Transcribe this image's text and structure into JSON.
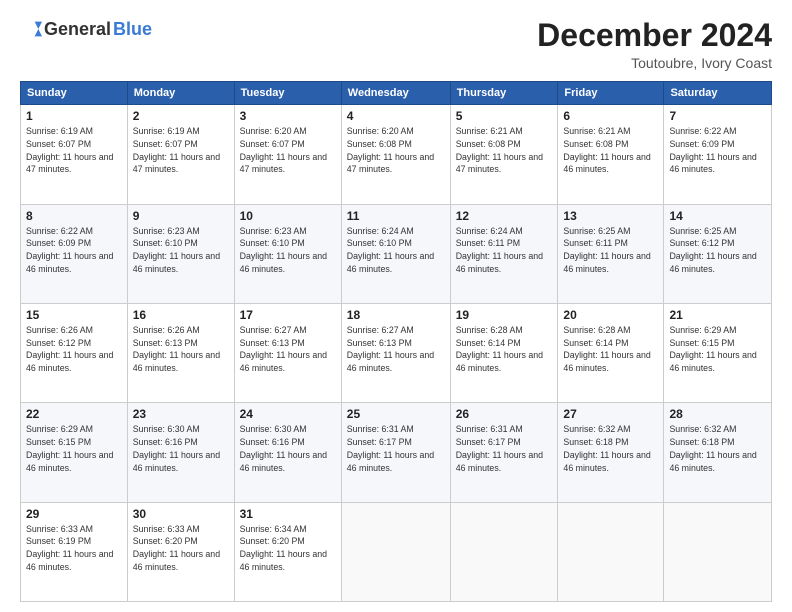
{
  "logo": {
    "general": "General",
    "blue": "Blue"
  },
  "header": {
    "month": "December 2024",
    "location": "Toutoubre, Ivory Coast"
  },
  "weekdays": [
    "Sunday",
    "Monday",
    "Tuesday",
    "Wednesday",
    "Thursday",
    "Friday",
    "Saturday"
  ],
  "weeks": [
    [
      {
        "day": "1",
        "sunrise": "6:19 AM",
        "sunset": "6:07 PM",
        "daylight": "11 hours and 47 minutes."
      },
      {
        "day": "2",
        "sunrise": "6:19 AM",
        "sunset": "6:07 PM",
        "daylight": "11 hours and 47 minutes."
      },
      {
        "day": "3",
        "sunrise": "6:20 AM",
        "sunset": "6:07 PM",
        "daylight": "11 hours and 47 minutes."
      },
      {
        "day": "4",
        "sunrise": "6:20 AM",
        "sunset": "6:08 PM",
        "daylight": "11 hours and 47 minutes."
      },
      {
        "day": "5",
        "sunrise": "6:21 AM",
        "sunset": "6:08 PM",
        "daylight": "11 hours and 47 minutes."
      },
      {
        "day": "6",
        "sunrise": "6:21 AM",
        "sunset": "6:08 PM",
        "daylight": "11 hours and 46 minutes."
      },
      {
        "day": "7",
        "sunrise": "6:22 AM",
        "sunset": "6:09 PM",
        "daylight": "11 hours and 46 minutes."
      }
    ],
    [
      {
        "day": "8",
        "sunrise": "6:22 AM",
        "sunset": "6:09 PM",
        "daylight": "11 hours and 46 minutes."
      },
      {
        "day": "9",
        "sunrise": "6:23 AM",
        "sunset": "6:10 PM",
        "daylight": "11 hours and 46 minutes."
      },
      {
        "day": "10",
        "sunrise": "6:23 AM",
        "sunset": "6:10 PM",
        "daylight": "11 hours and 46 minutes."
      },
      {
        "day": "11",
        "sunrise": "6:24 AM",
        "sunset": "6:10 PM",
        "daylight": "11 hours and 46 minutes."
      },
      {
        "day": "12",
        "sunrise": "6:24 AM",
        "sunset": "6:11 PM",
        "daylight": "11 hours and 46 minutes."
      },
      {
        "day": "13",
        "sunrise": "6:25 AM",
        "sunset": "6:11 PM",
        "daylight": "11 hours and 46 minutes."
      },
      {
        "day": "14",
        "sunrise": "6:25 AM",
        "sunset": "6:12 PM",
        "daylight": "11 hours and 46 minutes."
      }
    ],
    [
      {
        "day": "15",
        "sunrise": "6:26 AM",
        "sunset": "6:12 PM",
        "daylight": "11 hours and 46 minutes."
      },
      {
        "day": "16",
        "sunrise": "6:26 AM",
        "sunset": "6:13 PM",
        "daylight": "11 hours and 46 minutes."
      },
      {
        "day": "17",
        "sunrise": "6:27 AM",
        "sunset": "6:13 PM",
        "daylight": "11 hours and 46 minutes."
      },
      {
        "day": "18",
        "sunrise": "6:27 AM",
        "sunset": "6:13 PM",
        "daylight": "11 hours and 46 minutes."
      },
      {
        "day": "19",
        "sunrise": "6:28 AM",
        "sunset": "6:14 PM",
        "daylight": "11 hours and 46 minutes."
      },
      {
        "day": "20",
        "sunrise": "6:28 AM",
        "sunset": "6:14 PM",
        "daylight": "11 hours and 46 minutes."
      },
      {
        "day": "21",
        "sunrise": "6:29 AM",
        "sunset": "6:15 PM",
        "daylight": "11 hours and 46 minutes."
      }
    ],
    [
      {
        "day": "22",
        "sunrise": "6:29 AM",
        "sunset": "6:15 PM",
        "daylight": "11 hours and 46 minutes."
      },
      {
        "day": "23",
        "sunrise": "6:30 AM",
        "sunset": "6:16 PM",
        "daylight": "11 hours and 46 minutes."
      },
      {
        "day": "24",
        "sunrise": "6:30 AM",
        "sunset": "6:16 PM",
        "daylight": "11 hours and 46 minutes."
      },
      {
        "day": "25",
        "sunrise": "6:31 AM",
        "sunset": "6:17 PM",
        "daylight": "11 hours and 46 minutes."
      },
      {
        "day": "26",
        "sunrise": "6:31 AM",
        "sunset": "6:17 PM",
        "daylight": "11 hours and 46 minutes."
      },
      {
        "day": "27",
        "sunrise": "6:32 AM",
        "sunset": "6:18 PM",
        "daylight": "11 hours and 46 minutes."
      },
      {
        "day": "28",
        "sunrise": "6:32 AM",
        "sunset": "6:18 PM",
        "daylight": "11 hours and 46 minutes."
      }
    ],
    [
      {
        "day": "29",
        "sunrise": "6:33 AM",
        "sunset": "6:19 PM",
        "daylight": "11 hours and 46 minutes."
      },
      {
        "day": "30",
        "sunrise": "6:33 AM",
        "sunset": "6:20 PM",
        "daylight": "11 hours and 46 minutes."
      },
      {
        "day": "31",
        "sunrise": "6:34 AM",
        "sunset": "6:20 PM",
        "daylight": "11 hours and 46 minutes."
      },
      null,
      null,
      null,
      null
    ]
  ]
}
